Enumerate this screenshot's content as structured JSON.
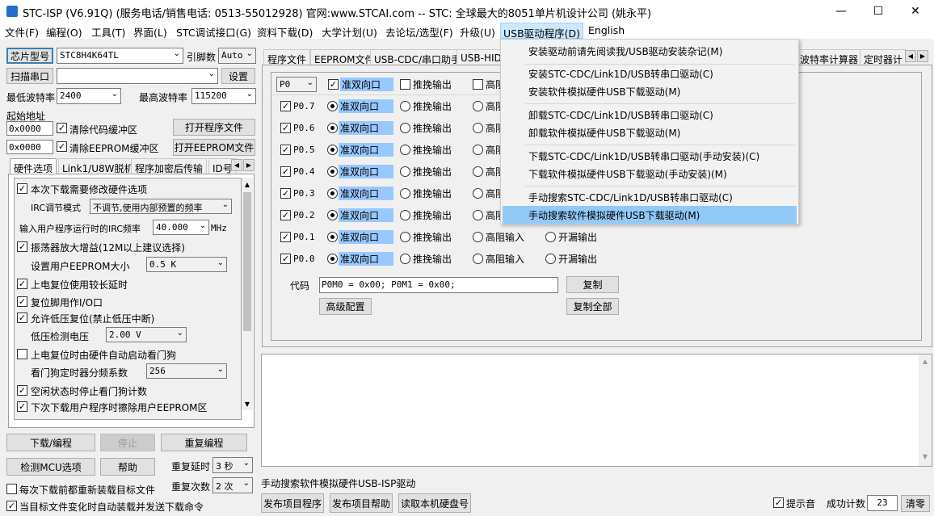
{
  "window": {
    "title": "STC-ISP (V6.91Q) (服务电话/销售电话: 0513-55012928) 官网:www.STCAI.com  -- STC: 全球最大的8051单片机设计公司 (姚永平)",
    "minimize": "—",
    "maximize": "☐",
    "close": "✕"
  },
  "menu": [
    "文件(F)",
    "编程(O)",
    "工具(T)",
    "界面(L)",
    "STC调试接口(G)",
    "资料下载(D)",
    "大学计划(U)",
    "去论坛/选型(F)",
    "升级(U)",
    "USB驱动程序(D)",
    "English"
  ],
  "left": {
    "chip_type_btn": "芯片型号",
    "chip_value": "STC8H4K64TL",
    "pin_label": "引脚数",
    "pin_value": "Auto",
    "scan_btn": "扫描串口",
    "port_value": "",
    "settings_btn": "设置",
    "min_baud_label": "最低波特率",
    "min_baud": "2400",
    "max_baud_label": "最高波特率",
    "max_baud": "115200",
    "start_addr_label": "起始地址",
    "addr1": "0x0000",
    "clear_code": "清除代码缓冲区",
    "open_prog": "打开程序文件",
    "addr2": "0x0000",
    "clear_eeprom": "清除EEPROM缓冲区",
    "open_eeprom": "打开EEPROM文件",
    "tabs": [
      "硬件选项",
      "Link1/U8W脱机",
      "程序加密后传输",
      "ID号"
    ],
    "hw": {
      "opt1": "本次下载需要修改硬件选项",
      "irc_mode_label": "IRC调节模式",
      "irc_mode_value": "不调节,使用内部预置的频率",
      "irc_freq_label": "输入用户程序运行时的IRC频率",
      "irc_freq_value": "40.000",
      "irc_freq_unit": "MHz",
      "opt_osc": "振荡器放大增益(12M以上建议选择)",
      "eeprom_size_label": "设置用户EEPROM大小",
      "eeprom_size_value": "0.5 K",
      "opt_reset_delay": "上电复位使用较长延时",
      "opt_reset_io": "复位脚用作I/O口",
      "opt_lvr": "允许低压复位(禁止低压中断)",
      "lvd_label": "低压检测电压",
      "lvd_value": "2.00 V",
      "opt_wdt": "上电复位时由硬件自动启动看门狗",
      "wdt_label": "看门狗定时器分频系数",
      "wdt_value": "256",
      "opt_idle": "空闲状态时停止看门狗计数",
      "opt_erase": "下次下载用户程序时擦除用户EEPROM区"
    },
    "download_btn": "下载/编程",
    "stop_btn": "停止",
    "reprog_btn": "重复编程",
    "detect_btn": "检测MCU选项",
    "help_btn": "帮助",
    "repeat_delay_label": "重复延时",
    "repeat_delay_value": "3 秒",
    "repeat_count_label": "重复次数",
    "repeat_count_value": "2 次",
    "reload_each": "每次下载前都重新装载目标文件",
    "auto_reload": "当目标文件变化时自动装载并发送下载命令"
  },
  "right": {
    "tabs": [
      "程序文件",
      "EEPROM文件",
      "USB-CDC/串口助手",
      "USB-HID",
      "波特率计算器",
      "定时器计"
    ],
    "port_select": "P0",
    "modes": [
      "准双向口",
      "推挽输出",
      "高阻输入",
      "开漏输出"
    ],
    "pins": [
      "P0.7",
      "P0.6",
      "P0.5",
      "P0.4",
      "P0.3",
      "P0.2",
      "P0.1",
      "P0.0"
    ],
    "code_label": "代码",
    "code_value": "P0M0 = 0x00; P0M1 = 0x00;",
    "copy_btn": "复制",
    "adv_btn": "高级配置",
    "copy_all_btn": "复制全部"
  },
  "dropdown": {
    "items": [
      "安装驱动前请先阅读我/USB驱动安装杂记(M)",
      "安装STC-CDC/Link1D/USB转串口驱动(C)",
      "安装软件模拟硬件USB下载驱动(M)",
      "卸载STC-CDC/Link1D/USB转串口驱动(C)",
      "卸载软件模拟硬件USB下载驱动(M)",
      "下载STC-CDC/Link1D/USB转串口驱动(手动安装)(C)",
      "下载软件模拟硬件USB下载驱动(手动安装)(M)",
      "手动搜索STC-CDC/Link1D/USB转串口驱动(C)",
      "手动搜索软件模拟硬件USB下载驱动(M)"
    ]
  },
  "statusbar": {
    "message": "手动搜索软件模拟硬件USB-ISP驱动",
    "publish_btn": "发布项目程序",
    "publish_help_btn": "发布项目帮助",
    "read_disk_btn": "读取本机硬盘号",
    "sound_label": "提示音",
    "success_label": "成功计数",
    "success_count": "23",
    "clear_btn": "清零"
  }
}
